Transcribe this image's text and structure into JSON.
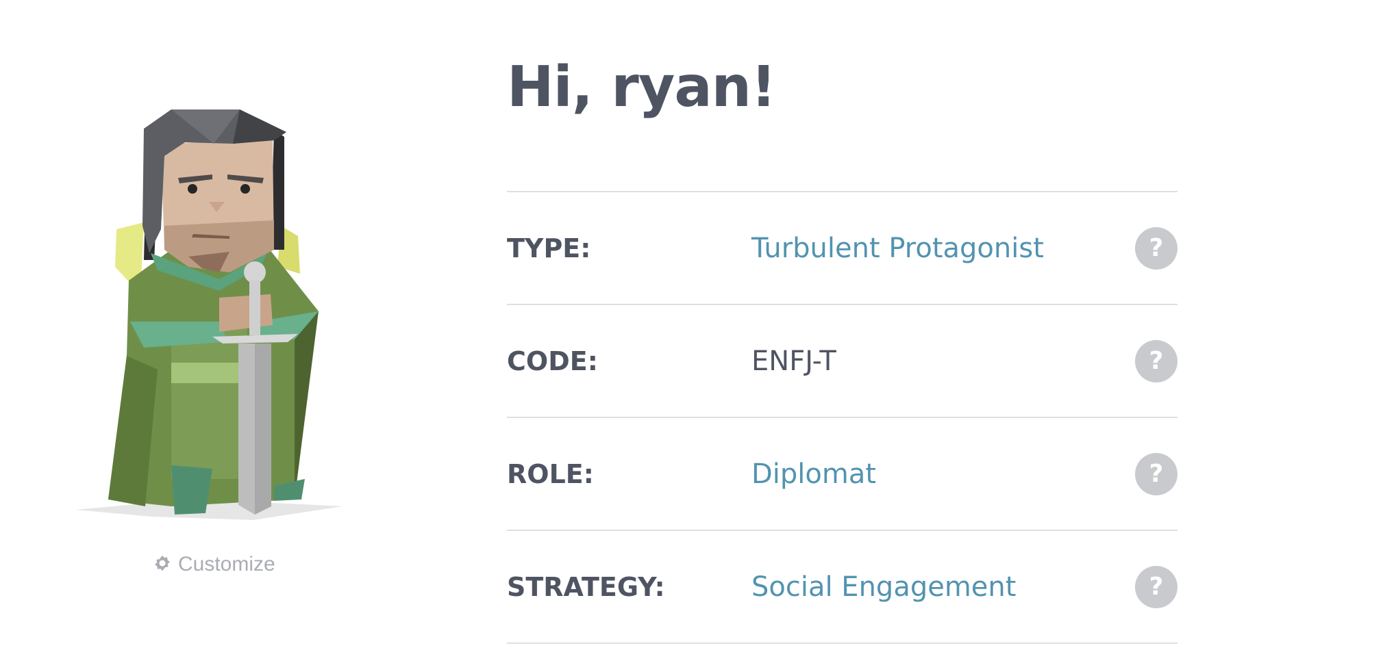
{
  "greeting": "Hi, ryan!",
  "avatar": {
    "icon": "protagonist-character-illustration",
    "customize_label": "Customize",
    "customize_icon": "gear-icon"
  },
  "rows": [
    {
      "label": "TYPE:",
      "value": "Turbulent Protagonist",
      "linked": true,
      "help_icon": "question-mark-icon",
      "help_glyph": "?"
    },
    {
      "label": "CODE:",
      "value": "ENFJ-T",
      "linked": false,
      "help_icon": "question-mark-icon",
      "help_glyph": "?"
    },
    {
      "label": "ROLE:",
      "value": "Diplomat",
      "linked": true,
      "help_icon": "question-mark-icon",
      "help_glyph": "?"
    },
    {
      "label": "STRATEGY:",
      "value": "Social Engagement",
      "linked": true,
      "help_icon": "question-mark-icon",
      "help_glyph": "?"
    }
  ],
  "colors": {
    "heading": "#4f5463",
    "link": "#5293b0",
    "divider": "#dddfe2",
    "help_button": "#c8cacd",
    "muted": "#a9acb2"
  }
}
